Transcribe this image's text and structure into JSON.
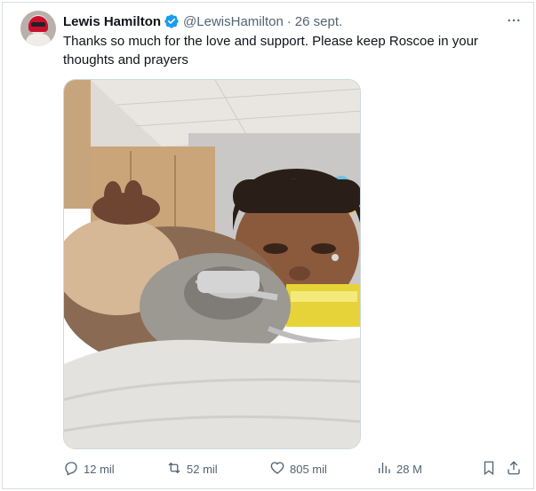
{
  "tweet": {
    "author_name": "Lewis Hamilton",
    "handle": "@LewisHamilton",
    "separator": "·",
    "timestamp": "26 sept.",
    "text": "Thanks so much for the love and support. Please keep Roscoe in your thoughts and prayers",
    "verified_color": "#1d9bf0"
  },
  "actions": {
    "replies": "12 mil",
    "retweets": "52 mil",
    "likes": "805 mil",
    "views": "28 M"
  },
  "icons": [
    "more-icon",
    "verified-badge-icon",
    "reply-icon",
    "retweet-icon",
    "like-icon",
    "views-icon",
    "bookmark-icon",
    "share-icon"
  ]
}
